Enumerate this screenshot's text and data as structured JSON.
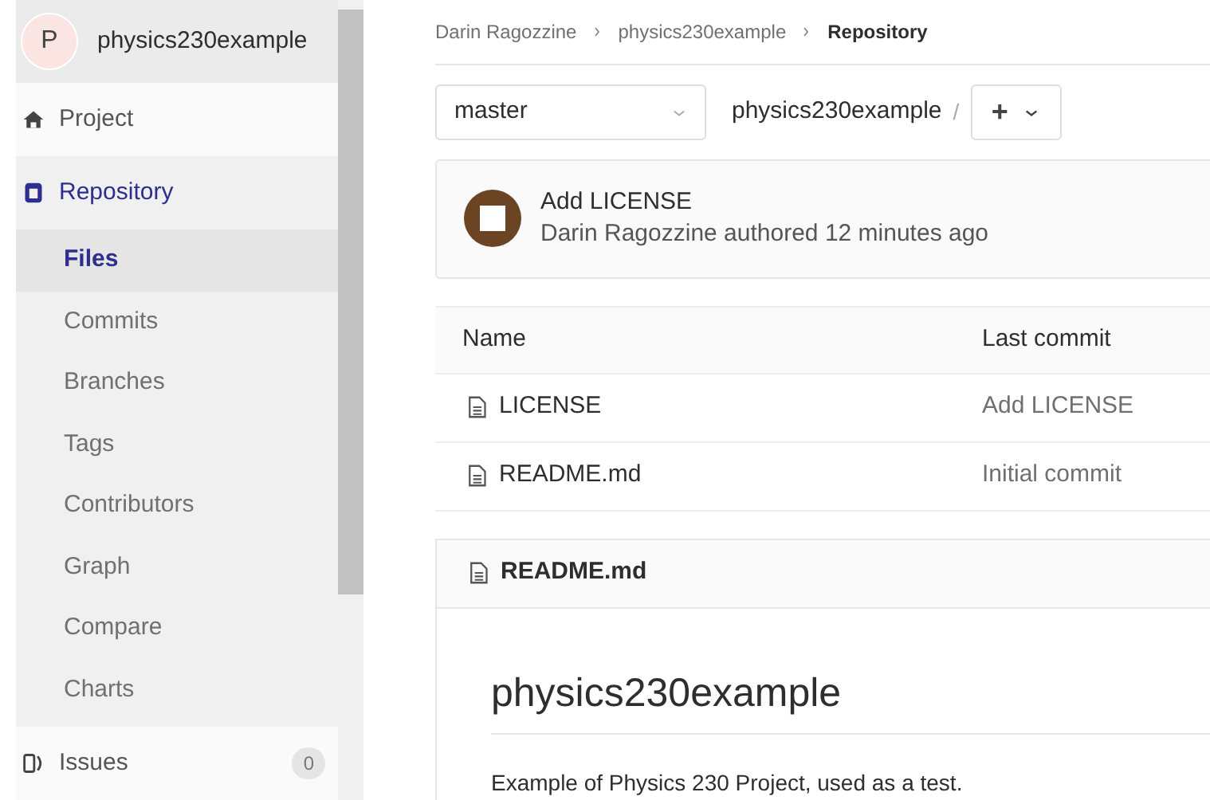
{
  "sidebar": {
    "avatar_letter": "P",
    "project_name": "physics230example",
    "items": [
      {
        "label": "Project",
        "kind": "project",
        "selected": false
      },
      {
        "label": "Repository",
        "kind": "repository",
        "selected": true,
        "children": [
          {
            "label": "Files",
            "selected": true
          },
          {
            "label": "Commits",
            "selected": false
          },
          {
            "label": "Branches",
            "selected": false
          },
          {
            "label": "Tags",
            "selected": false
          },
          {
            "label": "Contributors",
            "selected": false
          },
          {
            "label": "Graph",
            "selected": false
          },
          {
            "label": "Compare",
            "selected": false
          },
          {
            "label": "Charts",
            "selected": false
          }
        ]
      },
      {
        "label": "Issues",
        "kind": "issues",
        "selected": false,
        "count": "0"
      }
    ]
  },
  "breadcrumb": [
    "Darin Ragozzine",
    "physics230example",
    "Repository"
  ],
  "branch": "master",
  "path": "physics230example",
  "path_separator": "/",
  "add_button": "+",
  "last_commit": {
    "title": "Add LICENSE",
    "meta": "Darin Ragozzine authored 12 minutes ago"
  },
  "table": {
    "columns": [
      "Name",
      "Last commit"
    ],
    "rows": [
      {
        "name": "LICENSE",
        "last_commit": "Add LICENSE"
      },
      {
        "name": "README.md",
        "last_commit": "Initial commit"
      }
    ]
  },
  "readme": {
    "filename": "README.md",
    "heading": "physics230example",
    "paragraph": "Example of Physics 230 Project, used as a test."
  }
}
